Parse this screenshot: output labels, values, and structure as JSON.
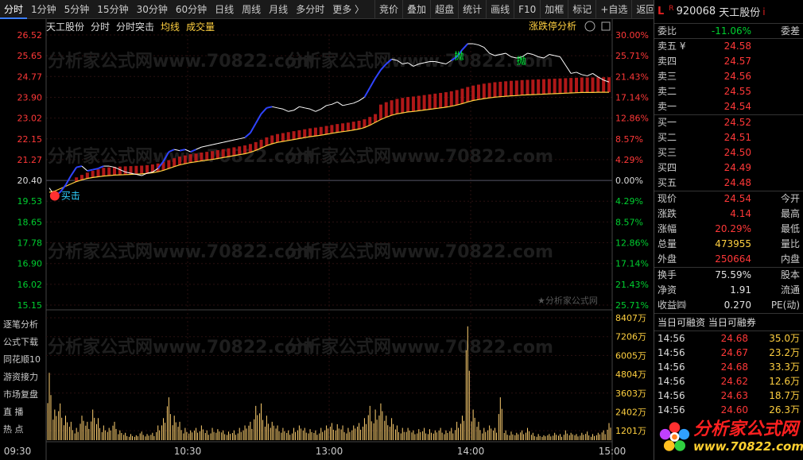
{
  "toolbar": {
    "tabs": [
      "分时",
      "1分钟",
      "5分钟",
      "15分钟",
      "30分钟",
      "60分钟",
      "日线",
      "周线",
      "月线",
      "多分时",
      "更多 〉"
    ],
    "tools": [
      "竞价",
      "叠加",
      "超盘",
      "统计",
      "画线",
      "F10",
      "加框",
      "标记",
      "+自选",
      "返回"
    ]
  },
  "legend": {
    "name": "天工股份",
    "mode": "分时",
    "indicator": "分时突击",
    "avg": "均线",
    "vol": "成交量",
    "limit_analysis": "涨跌停分析",
    "watermark_note": "★分析家公式网"
  },
  "markers": {
    "buy": "买击",
    "sell1": "抛",
    "sell2": "抛"
  },
  "sidebar": [
    "逐笔分析",
    "公式下载",
    "同花顺10",
    "游资接力",
    "市场复盘",
    "直  播",
    "热  点"
  ],
  "axis": {
    "price_ticks": [
      "26.52",
      "25.65",
      "24.77",
      "23.90",
      "23.02",
      "22.15",
      "21.27",
      "20.40",
      "19.53",
      "18.65",
      "17.78",
      "16.90",
      "16.02",
      "15.15"
    ],
    "pct_ticks": [
      "30.00%",
      "25.71%",
      "21.43%",
      "17.14%",
      "12.86%",
      "8.57%",
      "4.29%",
      "0.00%",
      "4.29%",
      "8.57%",
      "12.86%",
      "17.14%",
      "21.43%",
      "25.71%"
    ],
    "vol_ticks": [
      "8407万",
      "7206万",
      "6005万",
      "4804万",
      "3603万",
      "2402万",
      "1201万"
    ],
    "time_ticks": [
      "09:30",
      "10:30",
      "13:00",
      "14:00",
      "15:00"
    ]
  },
  "stock": {
    "code": "920068",
    "name": "天工股份",
    "L": "L",
    "R": "R",
    "i": "i",
    "weibi_label": "委比",
    "weibi": "-11.06%",
    "weicha_label": "委差",
    "ask": [
      {
        "label": "卖五 ¥",
        "price": "24.58"
      },
      {
        "label": "卖四",
        "price": "24.57"
      },
      {
        "label": "卖三",
        "price": "24.56"
      },
      {
        "label": "卖二",
        "price": "24.55"
      },
      {
        "label": "卖一",
        "price": "24.54"
      }
    ],
    "bid": [
      {
        "label": "买一",
        "price": "24.52"
      },
      {
        "label": "买二",
        "price": "24.51"
      },
      {
        "label": "买三",
        "price": "24.50"
      },
      {
        "label": "买四",
        "price": "24.49"
      },
      {
        "label": "买五",
        "price": "24.48"
      }
    ],
    "stats": [
      {
        "k": "现价",
        "v": "24.54",
        "c": "red",
        "q": "今开"
      },
      {
        "k": "涨跌",
        "v": "4.14",
        "c": "red",
        "q": "最高"
      },
      {
        "k": "涨幅",
        "v": "20.29%",
        "c": "red",
        "q": "最低"
      },
      {
        "k": "总量",
        "v": "473955",
        "c": "yellow",
        "q": "量比"
      },
      {
        "k": "外盘",
        "v": "250664",
        "c": "red",
        "q": "内盘"
      }
    ],
    "stats2": [
      {
        "k": "换手",
        "v": "75.59%",
        "c": "white",
        "q": "股本"
      },
      {
        "k": "净资",
        "v": "1.91",
        "c": "white",
        "q": "流通"
      },
      {
        "k": "收益㈣",
        "v": "0.270",
        "c": "white",
        "q": "PE(动)"
      }
    ],
    "margin_hdr": "当日可融资  当日可融券",
    "trades": [
      {
        "t": "14:56",
        "p": "24.68",
        "n": "35.0万"
      },
      {
        "t": "14:56",
        "p": "24.67",
        "n": "23.2万"
      },
      {
        "t": "14:56",
        "p": "24.68",
        "n": "33.3万"
      },
      {
        "t": "14:56",
        "p": "24.62",
        "n": "12.6万"
      },
      {
        "t": "14:56",
        "p": "24.63",
        "n": "18.7万"
      },
      {
        "t": "14:56",
        "p": "24.60",
        "n": "26.3万"
      }
    ]
  },
  "logo": {
    "text": "分析家公式网",
    "url": "www.70822.com"
  },
  "watermark": "分析家公式网www.70822.com",
  "colors": {
    "up": "#ff3838",
    "down": "#00d030",
    "price_line": "#ffffff",
    "avg_line": "#ffd040",
    "active_line": "#2f44ff",
    "vol_bar": "#ffd070"
  },
  "series": {
    "price": [
      20.08,
      19.75,
      19.9,
      20.2,
      20.6,
      20.95,
      21.0,
      20.8,
      20.85,
      20.9,
      21.0,
      21.0,
      20.95,
      20.85,
      20.75,
      20.7,
      20.65,
      20.6,
      20.7,
      20.75,
      20.9,
      21.2,
      21.6,
      21.7,
      21.65,
      21.7,
      21.6,
      21.7,
      21.8,
      21.85,
      21.9,
      21.95,
      22.0,
      22.05,
      22.1,
      22.15,
      22.2,
      22.4,
      22.8,
      23.2,
      23.45,
      23.5,
      23.45,
      23.4,
      23.3,
      23.35,
      23.5,
      23.45,
      23.4,
      23.3,
      23.4,
      23.55,
      23.6,
      23.7,
      23.55,
      23.6,
      23.65,
      23.75,
      23.9,
      24.3,
      24.7,
      25.05,
      25.3,
      25.5,
      25.45,
      25.3,
      25.35,
      25.2,
      25.3,
      25.35,
      25.4,
      25.4,
      25.35,
      25.3,
      25.45,
      25.6,
      25.9,
      26.15,
      26.15,
      26.1,
      26.0,
      25.75,
      25.65,
      25.7,
      25.75,
      25.6,
      25.55,
      25.6,
      25.75,
      25.7,
      25.6,
      25.55,
      25.7,
      25.65,
      25.6,
      25.25,
      24.9,
      24.95,
      24.85,
      24.8,
      24.9,
      24.75,
      24.62,
      24.54
    ],
    "avg": [
      19.9,
      19.95,
      20.05,
      20.15,
      20.25,
      20.35,
      20.42,
      20.48,
      20.52,
      20.55,
      20.58,
      20.6,
      20.62,
      20.63,
      20.64,
      20.65,
      20.66,
      20.67,
      20.69,
      20.72,
      20.76,
      20.82,
      20.9,
      20.98,
      21.05,
      21.1,
      21.15,
      21.18,
      21.22,
      21.25,
      21.28,
      21.32,
      21.36,
      21.4,
      21.44,
      21.48,
      21.52,
      21.58,
      21.66,
      21.76,
      21.86,
      21.94,
      22.0,
      22.04,
      22.08,
      22.12,
      22.16,
      22.2,
      22.24,
      22.27,
      22.3,
      22.34,
      22.38,
      22.42,
      22.45,
      22.48,
      22.52,
      22.56,
      22.62,
      22.72,
      22.84,
      22.96,
      23.06,
      23.14,
      23.2,
      23.24,
      23.28,
      23.3,
      23.33,
      23.36,
      23.39,
      23.42,
      23.45,
      23.48,
      23.52,
      23.57,
      23.63,
      23.7,
      23.76,
      23.8,
      23.84,
      23.87,
      23.9,
      23.92,
      23.94,
      23.96,
      23.97,
      23.99,
      24.0,
      24.01,
      24.02,
      24.03,
      24.04,
      24.05,
      24.06,
      24.07,
      24.08,
      24.09,
      24.1,
      24.1,
      24.1,
      24.11,
      24.11,
      24.11
    ],
    "vol": [
      0.55,
      0.25,
      0.3,
      0.2,
      0.15,
      0.1,
      0.2,
      0.15,
      0.25,
      0.18,
      0.12,
      0.1,
      0.15,
      0.08,
      0.06,
      0.05,
      0.04,
      0.07,
      0.05,
      0.06,
      0.12,
      0.18,
      0.35,
      0.2,
      0.15,
      0.1,
      0.08,
      0.1,
      0.12,
      0.08,
      0.1,
      0.09,
      0.08,
      0.07,
      0.08,
      0.1,
      0.12,
      0.15,
      0.28,
      0.3,
      0.2,
      0.15,
      0.12,
      0.1,
      0.08,
      0.1,
      0.12,
      0.1,
      0.09,
      0.08,
      0.1,
      0.12,
      0.14,
      0.13,
      0.12,
      0.1,
      0.12,
      0.14,
      0.18,
      0.28,
      0.25,
      0.3,
      0.2,
      0.18,
      0.12,
      0.1,
      0.1,
      0.08,
      0.09,
      0.1,
      0.09,
      0.08,
      0.1,
      0.08,
      0.1,
      0.15,
      0.2,
      0.93,
      0.25,
      0.15,
      0.1,
      0.12,
      0.1,
      0.35,
      0.08,
      0.07,
      0.06,
      0.08,
      0.1,
      0.06,
      0.05,
      0.04,
      0.05,
      0.06,
      0.05,
      0.08,
      0.06,
      0.05,
      0.06,
      0.07,
      0.05,
      0.06,
      0.08,
      0.14
    ]
  }
}
